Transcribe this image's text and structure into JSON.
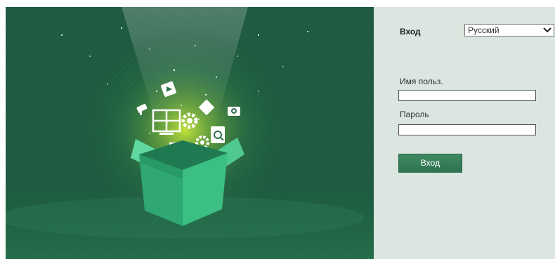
{
  "login": {
    "title": "Вход",
    "language_selected": "Русский",
    "username_label": "Имя польз.",
    "username_value": "",
    "password_label": "Пароль",
    "password_value": "",
    "submit_label": "Вход"
  },
  "icons": {
    "language_dropdown": "chevron-down-icon",
    "hero_illustration": "gift-box-with-feature-icons"
  },
  "colors": {
    "hero_background": "#1d5a3f",
    "panel_background": "#dae6df",
    "button": "#35795a",
    "box_green": "#2fba7c"
  }
}
